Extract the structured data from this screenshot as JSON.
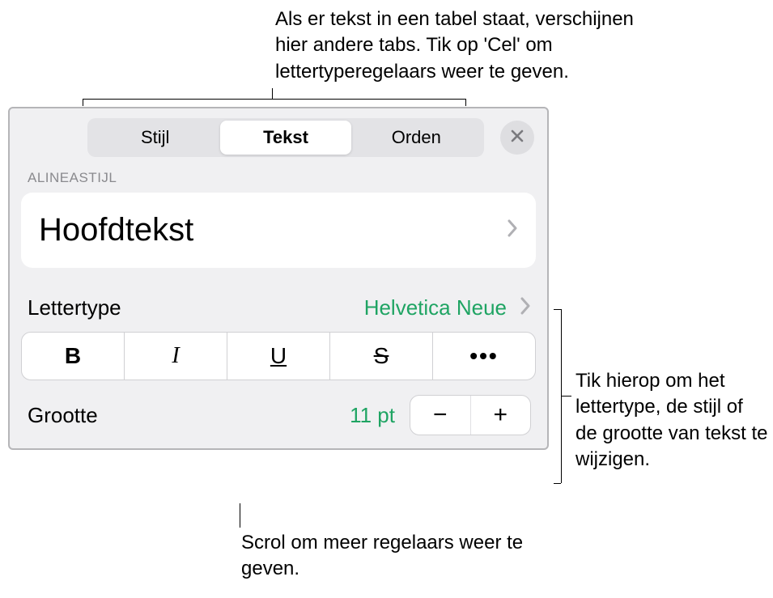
{
  "annotations": {
    "top": "Als er tekst in een tabel staat, verschijnen hier andere tabs. Tik op 'Cel' om lettertyperegelaars weer te geven.",
    "right": "Tik hierop om het lettertype, de stijl of de grootte van tekst te wijzigen.",
    "bottom": "Scrol om meer regelaars weer te geven."
  },
  "tabs": {
    "style": "Stijl",
    "text": "Tekst",
    "arrange": "Orden"
  },
  "section": {
    "paragraph_style_label": "ALINEASTIJL",
    "paragraph_style_value": "Hoofdtekst"
  },
  "font": {
    "label": "Lettertype",
    "value": "Helvetica Neue"
  },
  "format_buttons": {
    "bold": "B",
    "italic": "I",
    "underline": "U",
    "strike": "S",
    "more": "•••"
  },
  "size": {
    "label": "Grootte",
    "value": "11 pt",
    "minus": "−",
    "plus": "+"
  }
}
